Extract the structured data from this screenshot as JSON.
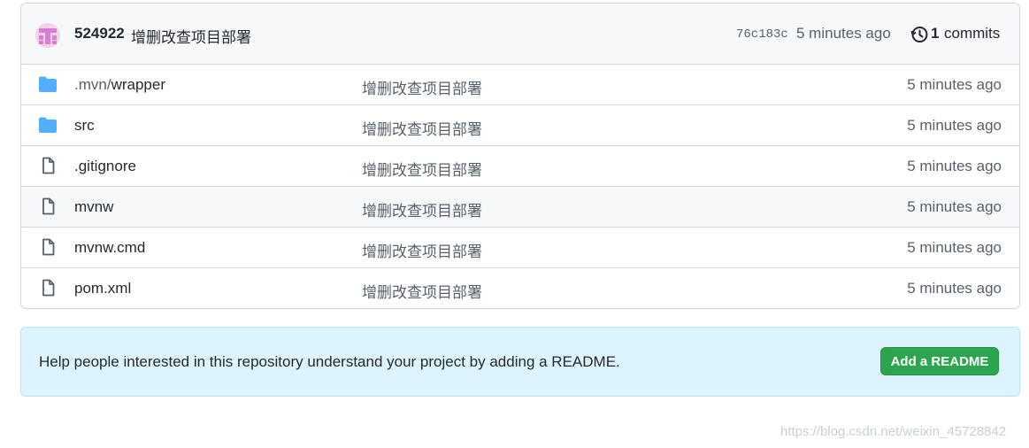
{
  "latest_commit": {
    "author": "524922",
    "message": "增删改查项目部署",
    "hash": "76c183c",
    "time": "5 minutes ago",
    "commit_count": "1",
    "commit_word": "commits"
  },
  "files": [
    {
      "type": "folder",
      "name_prefix": ".mvn/",
      "name": "wrapper",
      "message": "增删改查项目部署",
      "time": "5 minutes ago"
    },
    {
      "type": "folder",
      "name_prefix": "",
      "name": "src",
      "message": "增删改查项目部署",
      "time": "5 minutes ago"
    },
    {
      "type": "file",
      "name_prefix": "",
      "name": ".gitignore",
      "message": "增删改查项目部署",
      "time": "5 minutes ago"
    },
    {
      "type": "file",
      "name_prefix": "",
      "name": "mvnw",
      "message": "增删改查项目部署",
      "time": "5 minutes ago"
    },
    {
      "type": "file",
      "name_prefix": "",
      "name": "mvnw.cmd",
      "message": "增删改查项目部署",
      "time": "5 minutes ago"
    },
    {
      "type": "file",
      "name_prefix": "",
      "name": "pom.xml",
      "message": "增删改查项目部署",
      "time": "5 minutes ago"
    }
  ],
  "readme_banner": {
    "text": "Help people interested in this repository understand your project by adding a README.",
    "button_label": "Add a README"
  },
  "watermark": "https://blog.csdn.net/weixin_45728842",
  "colors": {
    "folder": "#54aeff",
    "file": "#57606a",
    "button": "#2da44e",
    "banner": "#ddf4ff"
  }
}
